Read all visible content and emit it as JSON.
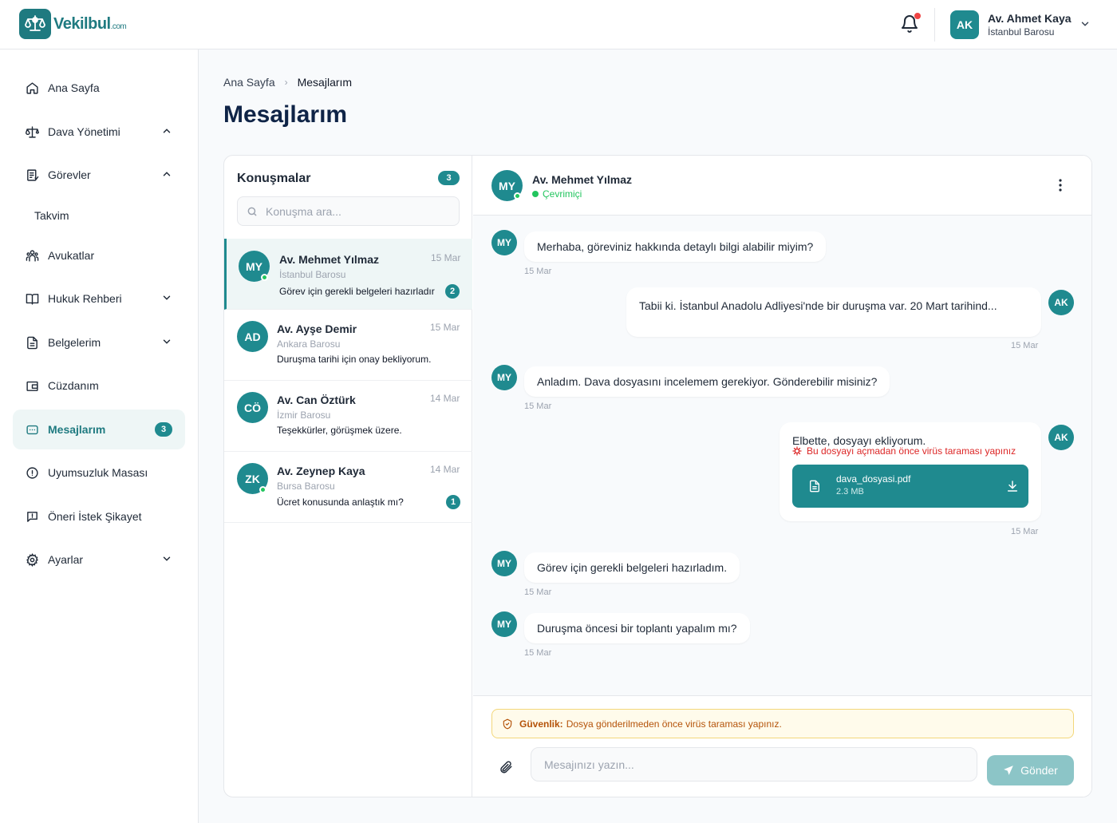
{
  "brand": {
    "name": "Vekilbul",
    "suffix": ".com"
  },
  "header": {
    "user_initials": "AK",
    "user_name": "Av. Ahmet Kaya",
    "user_bar": "İstanbul Barosu",
    "has_notification": true
  },
  "sidebar": {
    "items": [
      {
        "label": "Ana Sayfa",
        "icon": "home-icon"
      },
      {
        "label": "Dava Yönetimi",
        "icon": "scale-icon",
        "chevron": "up"
      },
      {
        "label": "Görevler",
        "icon": "task-icon",
        "chevron": "up"
      },
      {
        "label": "Takvim"
      },
      {
        "label": "Avukatlar",
        "icon": "users-icon"
      },
      {
        "label": "Hukuk Rehberi",
        "icon": "book-icon",
        "chevron": "down"
      },
      {
        "label": "Belgelerim",
        "icon": "document-icon",
        "chevron": "down"
      },
      {
        "label": "Cüzdanım",
        "icon": "wallet-icon"
      },
      {
        "label": "Mesajlarım",
        "icon": "message-icon",
        "badge": "3",
        "active": true
      },
      {
        "label": "Uyumsuzluk Masası",
        "icon": "alert-icon"
      },
      {
        "label": "Öneri İstek Şikayet",
        "icon": "feedback-icon"
      },
      {
        "label": "Ayarlar",
        "icon": "settings-icon",
        "chevron": "down"
      }
    ]
  },
  "breadcrumb": {
    "home": "Ana Sayfa",
    "separator": "›",
    "current": "Mesajlarım"
  },
  "page_title": "Mesajlarım",
  "conversations": {
    "title": "Konuşmalar",
    "count": "3",
    "search_placeholder": "Konuşma ara...",
    "items": [
      {
        "initials": "MY",
        "name": "Av. Mehmet Yılmaz",
        "bar": "İstanbul Barosu",
        "last": "Görev için gerekli belgeleri hazırladır",
        "date": "15 Mar",
        "unread": "2",
        "online": true,
        "active": true
      },
      {
        "initials": "AD",
        "name": "Av. Ayşe Demir",
        "bar": "Ankara Barosu",
        "last": "Duruşma tarihi için onay bekliyorum.",
        "date": "15 Mar"
      },
      {
        "initials": "CÖ",
        "name": "Av. Can Öztürk",
        "bar": "İzmir Barosu",
        "last": "Teşekkürler, görüşmek üzere.",
        "date": "14 Mar"
      },
      {
        "initials": "ZK",
        "name": "Av. Zeynep Kaya",
        "bar": "Bursa Barosu",
        "last": "Ücret konusunda anlaştık mı?",
        "date": "14 Mar",
        "unread": "1",
        "online": true
      }
    ]
  },
  "chat": {
    "contact_initials": "MY",
    "contact_name": "Av. Mehmet Yılmaz",
    "contact_status": "Çevrimiçi",
    "messages": [
      {
        "from": "MY",
        "text": "Merhaba, göreviniz hakkında detaylı bilgi alabilir miyim?",
        "time": "15 Mar"
      },
      {
        "from": "AK",
        "text": "Tabii ki. İstanbul Anadolu Adliyesi'nde bir duruşma var. 20 Mart tarihind...",
        "time": "15 Mar"
      },
      {
        "from": "MY",
        "text": "Anladım. Dava dosyasını incelemem gerekiyor. Gönderebilir misiniz?",
        "time": "15 Mar"
      },
      {
        "from": "AK",
        "text": "Elbette, dosyayı ekliyorum.",
        "warning": "Bu dosyayı açmadan önce virüs taraması yapınız",
        "file_name": "dava_dosyasi.pdf",
        "file_size": "2.3 MB",
        "time": "15 Mar"
      },
      {
        "from": "MY",
        "text": "Görev için gerekli belgeleri hazırladım.",
        "time": "15 Mar"
      },
      {
        "from": "MY",
        "text": "Duruşma öncesi bir toplantı yapalım mı?",
        "time": "15 Mar"
      }
    ],
    "security_label": "Güvenlik:",
    "security_text": "Dosya gönderilmeden önce virüs taraması yapınız.",
    "input_placeholder": "Mesajınızı yazın...",
    "send_label": "Gönder"
  },
  "colors": {
    "accent": "#1f8a8f",
    "accent_light": "#eef6f6",
    "online": "#22c55e",
    "warning": "#dc2626",
    "notice_bg": "#fffbeb"
  }
}
